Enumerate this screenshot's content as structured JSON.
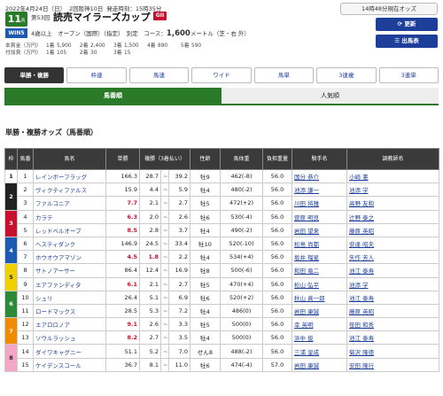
{
  "race": {
    "date": "2022年4月24日（日）",
    "meeting": "2回阪神10日",
    "post_time": "発走時刻：15時35分",
    "number": "11",
    "number_suffix": "R",
    "edition": "第53回",
    "name": "読売マイラーズカップ",
    "grade": "GII",
    "conditions": "4歳以上　オープン（国際）（指定）　別定　コース：",
    "distance": "1,600",
    "distance_unit": "メートル（芝・右 外）",
    "logo_text": "WIN5",
    "prize_rows": [
      [
        "本賞金（万円）",
        "1着",
        "5,900",
        "2着",
        "2,400",
        "3着",
        "1,500",
        "4着",
        "890",
        "5着",
        "590"
      ],
      [
        "付加賞（万円）",
        "1着",
        "105",
        "2着",
        "30",
        "3着",
        "15",
        "",
        "",
        "",
        ""
      ]
    ]
  },
  "controls": {
    "current_time": "14時48分現在オッズ",
    "refresh": "更新",
    "starters": "出馬表"
  },
  "odds_tabs": [
    "単勝・複勝",
    "枠連",
    "馬連",
    "ワイド",
    "馬単",
    "3連複",
    "3連単"
  ],
  "sort_tabs": [
    "馬番順",
    "人気順"
  ],
  "section_title": "単勝・複勝オッズ（馬番順）",
  "table": {
    "headers": [
      "枠",
      "馬番",
      "馬名",
      "単勝",
      "複勝（3着払い）",
      "性齢",
      "馬体重",
      "負担重量",
      "騎手名",
      "調教師名"
    ],
    "rows": [
      {
        "waku": "1",
        "num": "1",
        "horse": "レインボーフラッグ",
        "win": "166.3",
        "pl_min": "28.7",
        "pl_max": "39.2",
        "sex": "牡9",
        "weight": "462(-8)",
        "burden": "56.0",
        "jockey": "国分 恭介",
        "trainer": "小崎 憲"
      },
      {
        "waku": "2",
        "num": "2",
        "horse": "ヴィクティファルス",
        "win": "15.9",
        "pl_min": "4.4",
        "pl_max": "5.9",
        "sex": "牡4",
        "weight": "480(-2)",
        "burden": "56.0",
        "jockey": "池添 謙一",
        "trainer": "池添 学"
      },
      {
        "waku": "2",
        "num": "3",
        "horse": "ファルコニア",
        "win": "7.7",
        "pl_min": "2.1",
        "pl_max": "2.7",
        "sex": "牡5",
        "weight": "472(+2)",
        "burden": "56.0",
        "jockey": "川田 将雅",
        "trainer": "高野 友和"
      },
      {
        "waku": "3",
        "num": "4",
        "horse": "カラテ",
        "win": "6.3",
        "pl_min": "2.0",
        "pl_max": "2.6",
        "sex": "牡6",
        "weight": "530(-4)",
        "burden": "56.0",
        "jockey": "菅原 明良",
        "trainer": "辻野 泰之"
      },
      {
        "waku": "3",
        "num": "5",
        "horse": "レッドベルオーブ",
        "win": "8.5",
        "pl_min": "2.8",
        "pl_max": "3.7",
        "sex": "牡4",
        "weight": "490(-2)",
        "burden": "56.0",
        "jockey": "岩田 望来",
        "trainer": "藤原 英昭"
      },
      {
        "waku": "4",
        "num": "6",
        "horse": "ヘスティダンク",
        "win": "146.9",
        "pl_min": "24.5",
        "pl_max": "33.4",
        "sex": "牡10",
        "weight": "520(-10)",
        "burden": "56.0",
        "jockey": "松島 尚都",
        "trainer": "安達 昭夫"
      },
      {
        "waku": "4",
        "num": "7",
        "horse": "ホウオウアマゾン",
        "win": "4.5",
        "pl_min": "1.8",
        "pl_max": "2.2",
        "sex": "牡4",
        "weight": "534(+4)",
        "burden": "56.0",
        "jockey": "坂井 瑠星",
        "trainer": "矢作 芳人"
      },
      {
        "waku": "5",
        "num": "8",
        "horse": "サトノアーサー",
        "win": "86.4",
        "pl_min": "12.4",
        "pl_max": "16.9",
        "sex": "牡8",
        "weight": "500(-6)",
        "burden": "56.0",
        "jockey": "和田 竜二",
        "trainer": "池江 泰寿"
      },
      {
        "waku": "5",
        "num": "9",
        "horse": "エアファンディタ",
        "win": "6.1",
        "pl_min": "2.1",
        "pl_max": "2.7",
        "sex": "牡5",
        "weight": "470(+4)",
        "burden": "56.0",
        "jockey": "松山 弘平",
        "trainer": "池添 学"
      },
      {
        "waku": "6",
        "num": "10",
        "horse": "シュリ",
        "win": "26.4",
        "pl_min": "5.1",
        "pl_max": "6.9",
        "sex": "牡6",
        "weight": "520(+2)",
        "burden": "56.0",
        "jockey": "秋山 真一郎",
        "trainer": "池江 泰寿"
      },
      {
        "waku": "6",
        "num": "11",
        "horse": "ロードマックス",
        "win": "28.5",
        "pl_min": "5.3",
        "pl_max": "7.2",
        "sex": "牡4",
        "weight": "486(0)",
        "burden": "56.0",
        "jockey": "岩田 康誠",
        "trainer": "藤原 英昭"
      },
      {
        "waku": "7",
        "num": "12",
        "horse": "エアロロノア",
        "win": "9.1",
        "pl_min": "2.6",
        "pl_max": "3.3",
        "sex": "牡5",
        "weight": "500(0)",
        "burden": "56.0",
        "jockey": "幸 英明",
        "trainer": "笹田 和秀"
      },
      {
        "waku": "7",
        "num": "13",
        "horse": "ソウルラッシュ",
        "win": "8.2",
        "pl_min": "2.7",
        "pl_max": "3.5",
        "sex": "牡4",
        "weight": "500(0)",
        "burden": "56.0",
        "jockey": "浜中 俊",
        "trainer": "池江 泰寿"
      },
      {
        "waku": "8",
        "num": "14",
        "horse": "ダイワキャグニー",
        "win": "51.1",
        "pl_min": "5.2",
        "pl_max": "7.0",
        "sex": "せん8",
        "weight": "488(-2)",
        "burden": "56.0",
        "jockey": "三浦 皇成",
        "trainer": "菊沢 隆徳"
      },
      {
        "waku": "8",
        "num": "15",
        "horse": "ケイデンスコール",
        "win": "36.7",
        "pl_min": "8.1",
        "pl_max": "11.0",
        "sex": "牡6",
        "weight": "474(-4)",
        "burden": "57.0",
        "jockey": "岩田 康誠",
        "trainer": "安田 隆行"
      }
    ],
    "low_win_nums": [
      "3",
      "4",
      "5",
      "7",
      "9",
      "12",
      "13"
    ],
    "low_place_nums": [
      "7"
    ]
  },
  "colors": {
    "accent_green": "#2a7a2a",
    "nav_blue": "#1d3f9a",
    "grade_red": "#c8102e",
    "waku": {
      "1": "#ffffff",
      "2": "#222222",
      "3": "#c8102e",
      "4": "#1d5bb3",
      "5": "#f0d000",
      "6": "#2a8a3a",
      "7": "#f08a00",
      "8": "#f4a6c6"
    }
  }
}
